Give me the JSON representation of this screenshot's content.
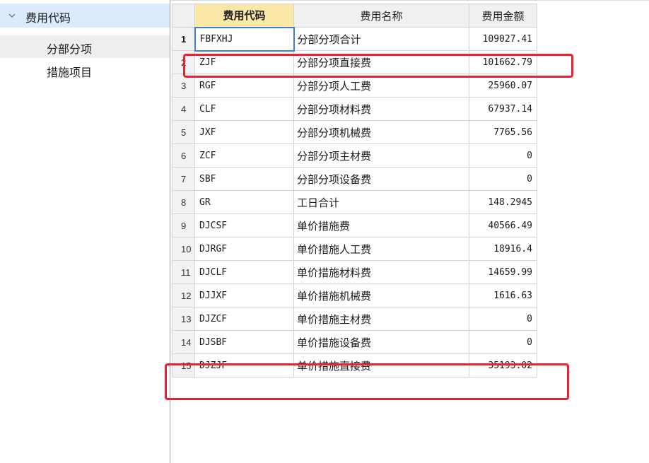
{
  "sidebar": {
    "root_label": "费用代码",
    "items": [
      {
        "label": "分部分项"
      },
      {
        "label": "措施项目"
      }
    ]
  },
  "table": {
    "headers": [
      "费用代码",
      "费用名称",
      "费用金额"
    ],
    "rows": [
      {
        "num": "1",
        "code": "FBFXHJ",
        "name": "分部分项合计",
        "amount": "109027.41"
      },
      {
        "num": "2",
        "code": "ZJF",
        "name": "分部分项直接费",
        "amount": "101662.79"
      },
      {
        "num": "3",
        "code": "RGF",
        "name": "分部分项人工费",
        "amount": "25960.07"
      },
      {
        "num": "4",
        "code": "CLF",
        "name": "分部分项材料费",
        "amount": "67937.14"
      },
      {
        "num": "5",
        "code": "JXF",
        "name": "分部分项机械费",
        "amount": "7765.56"
      },
      {
        "num": "6",
        "code": "ZCF",
        "name": "分部分项主材费",
        "amount": "0"
      },
      {
        "num": "7",
        "code": "SBF",
        "name": "分部分项设备费",
        "amount": "0"
      },
      {
        "num": "8",
        "code": "GR",
        "name": "工日合计",
        "amount": "148.2945"
      },
      {
        "num": "9",
        "code": "DJCSF",
        "name": "单价措施费",
        "amount": "40566.49"
      },
      {
        "num": "10",
        "code": "DJRGF",
        "name": "单价措施人工费",
        "amount": "18916.4"
      },
      {
        "num": "11",
        "code": "DJCLF",
        "name": "单价措施材料费",
        "amount": "14659.99"
      },
      {
        "num": "12",
        "code": "DJJXF",
        "name": "单价措施机械费",
        "amount": "1616.63"
      },
      {
        "num": "13",
        "code": "DJZCF",
        "name": "单价措施主材费",
        "amount": "0"
      },
      {
        "num": "14",
        "code": "DJSBF",
        "name": "单价措施设备费",
        "amount": "0"
      },
      {
        "num": "15",
        "code": "DJZJF",
        "name": "单价措施直接费",
        "amount": "35193.02"
      }
    ]
  },
  "icons": {
    "tree_toggle": "chevron-down-icon"
  },
  "colors": {
    "sidebar_root_bg": "#dcebfb",
    "selected_item_bg": "#eeeeee",
    "active_header_bg": "#fbe7a6",
    "annotation_red": "#e8232f",
    "focus_border": "#3c7fd4"
  }
}
